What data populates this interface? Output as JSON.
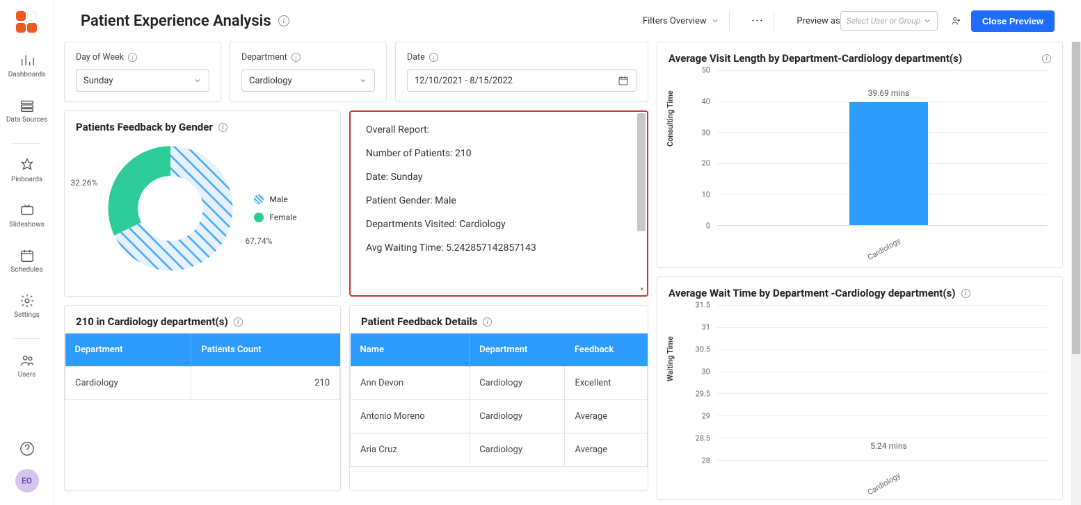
{
  "sidebar": {
    "items": [
      {
        "label": "Dashboards",
        "icon": "dashboards"
      },
      {
        "label": "Data Sources",
        "icon": "datasources"
      },
      {
        "label": "Pinboards",
        "icon": "pin"
      },
      {
        "label": "Slideshows",
        "icon": "slideshow"
      },
      {
        "label": "Schedules",
        "icon": "schedule"
      },
      {
        "label": "Settings",
        "icon": "settings"
      },
      {
        "label": "Users",
        "icon": "users"
      }
    ],
    "avatar": "EO"
  },
  "header": {
    "title": "Patient Experience Analysis",
    "filters_label": "Filters Overview",
    "preview_as_label": "Preview as",
    "user_select_placeholder": "Select User or Group",
    "close_btn": "Close Preview"
  },
  "filters": {
    "day_label": "Day of Week",
    "day_value": "Sunday",
    "dept_label": "Department",
    "dept_value": "Cardiology",
    "date_label": "Date",
    "date_value": "12/10/2021 - 8/15/2022"
  },
  "gender_widget": {
    "title": "Patients Feedback by Gender",
    "legend": [
      {
        "label": "Male",
        "color": "#4aa8ff"
      },
      {
        "label": "Female",
        "color": "#2ecc9a"
      }
    ],
    "male_pct": "67.74%",
    "female_pct": "32.26%"
  },
  "report": {
    "l1": "Overall Report:",
    "l2": "Number of Patients: 210",
    "l3": "Date: Sunday",
    "l4": "Patient Gender: Male",
    "l5": "Departments Visited: Cardiology",
    "l6": "Avg Waiting Time: 5.242857142857143"
  },
  "dept_table": {
    "title": "210 in Cardiology department(s)",
    "cols": [
      "Department",
      "Patients Count"
    ],
    "rows": [
      [
        "Cardiology",
        "210"
      ]
    ]
  },
  "feedback_table": {
    "title": "Patient Feedback Details",
    "cols": [
      "Name",
      "Department",
      "Feedback"
    ],
    "rows": [
      [
        "Ann Devon",
        "Cardiology",
        "Excellent"
      ],
      [
        "Antonio Moreno",
        "Cardiology",
        "Average"
      ],
      [
        "Aria Cruz",
        "Cardiology",
        "Average"
      ]
    ]
  },
  "chart_data": [
    {
      "type": "bar",
      "title": "Average Visit Length by Department-Cardiology department(s)",
      "ylabel": "Consulting Time",
      "categories": [
        "Cardiology"
      ],
      "values": [
        39.69
      ],
      "value_labels": [
        "39.69 mins"
      ],
      "ylim": [
        0,
        50
      ],
      "yticks": [
        0,
        10,
        20,
        30,
        40,
        50
      ]
    },
    {
      "type": "bar",
      "title": "Average Wait Time by Department -Cardiology department(s)",
      "ylabel": "Waiting Time",
      "categories": [
        "Cardiology"
      ],
      "values": [
        5.24
      ],
      "value_labels": [
        "5.24 mins"
      ],
      "ylim": [
        28,
        31.5
      ],
      "yticks": [
        28,
        28.5,
        29,
        29.5,
        30,
        30.5,
        31,
        31.5
      ]
    }
  ]
}
